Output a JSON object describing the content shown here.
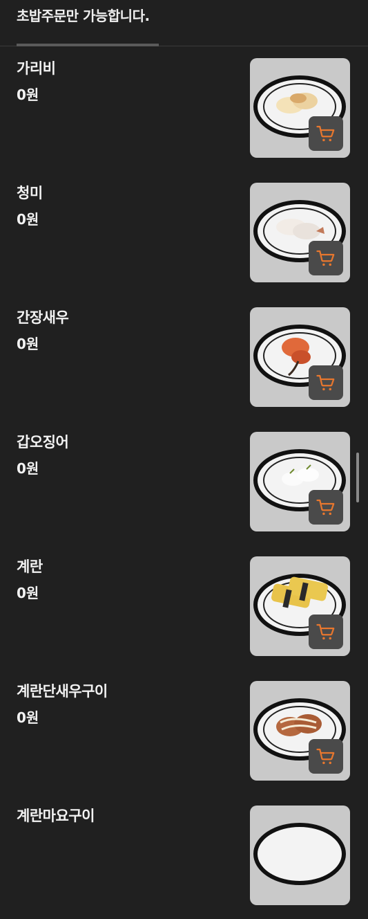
{
  "header": {
    "notice": "초밥주문만 가능합니다."
  },
  "menu": {
    "items": [
      {
        "name": "가리비",
        "price": "0원",
        "food": "scallop"
      },
      {
        "name": "청미",
        "price": "0원",
        "food": "shrimp-white"
      },
      {
        "name": "간장새우",
        "price": "0원",
        "food": "soy-shrimp"
      },
      {
        "name": "갑오징어",
        "price": "0원",
        "food": "squid"
      },
      {
        "name": "계란",
        "price": "0원",
        "food": "egg"
      },
      {
        "name": "계란단새우구이",
        "price": "0원",
        "food": "egg-shrimp-grill"
      },
      {
        "name": "계란마요구이",
        "price": "",
        "food": "egg-mayo"
      }
    ]
  },
  "icons": {
    "cart": "cart-icon"
  },
  "colors": {
    "background": "#202020",
    "cart_icon": "#e8772e",
    "cart_button": "#4a4a4a",
    "thumbnail_bg": "#c9c9c9"
  }
}
